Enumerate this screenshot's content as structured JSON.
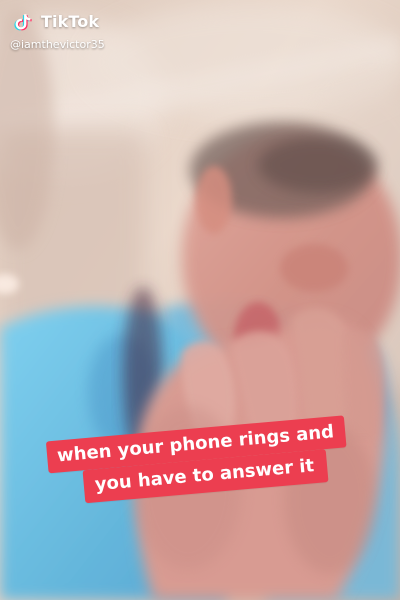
{
  "watermark": {
    "brand": "TikTok",
    "username": "@iamthevictor35",
    "icon": "tiktok-note-icon"
  },
  "caption": {
    "lines": [
      "when your phone rings and",
      "you have to answer it"
    ],
    "background_color": "#ec3e50",
    "text_color": "#ffffff"
  }
}
